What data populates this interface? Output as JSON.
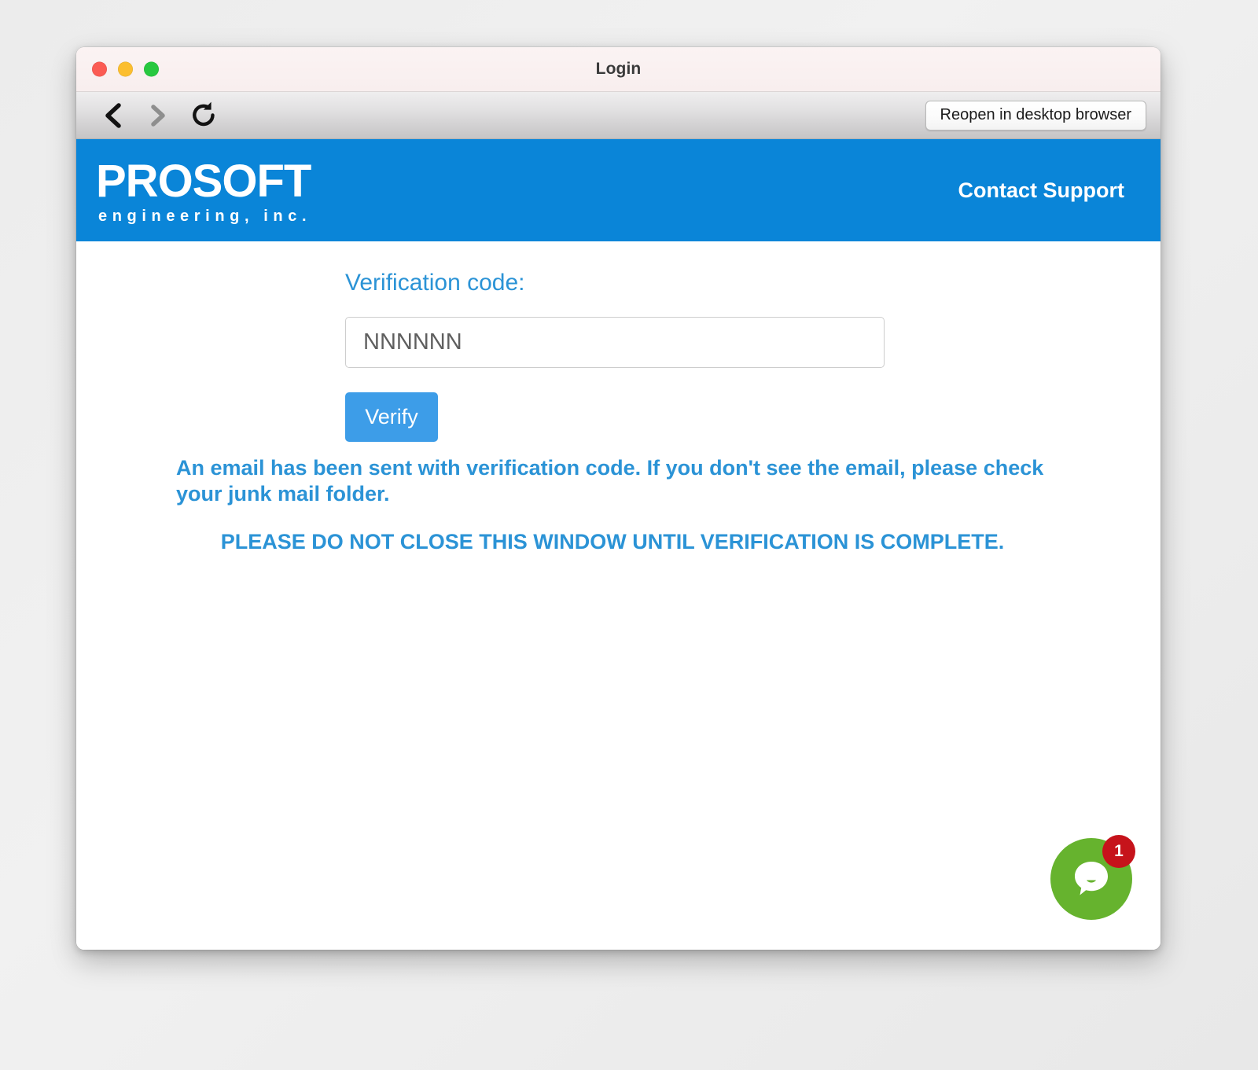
{
  "window": {
    "title": "Login",
    "traffic_lights": [
      "close",
      "minimize",
      "zoom"
    ]
  },
  "toolbar": {
    "back_icon": "chevron-left-icon",
    "forward_icon": "chevron-right-icon",
    "reload_icon": "reload-icon",
    "reopen_label": "Reopen in desktop browser"
  },
  "brand": {
    "logo_main": "PROSOFT",
    "logo_sub": "engineering, inc.",
    "contact_label": "Contact Support",
    "band_color": "#0a85d8"
  },
  "form": {
    "label": "Verification code:",
    "input_placeholder": "NNNNNN",
    "input_value": "",
    "verify_label": "Verify",
    "verify_color": "#3d9de8",
    "message": "An email has been sent with verification code. If you don't see the email, please check your junk mail folder.",
    "warning": "PLEASE DO NOT CLOSE THIS WINDOW UNTIL VERIFICATION IS COMPLETE.",
    "text_color": "#2b93d6"
  },
  "chat": {
    "icon": "chat-bubble-icon",
    "badge_count": "1",
    "circle_color": "#66b32e",
    "badge_color": "#c6131b"
  }
}
